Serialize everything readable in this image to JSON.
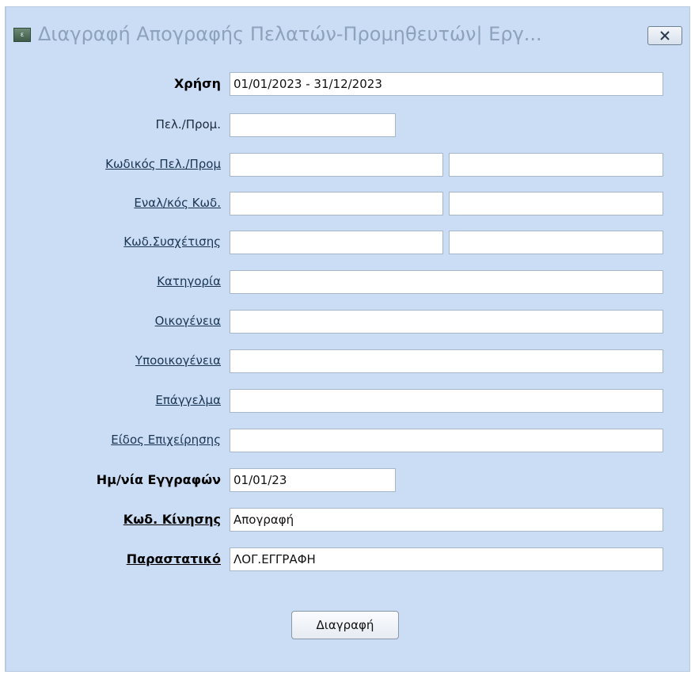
{
  "window": {
    "title": "Διαγραφή Απογραφής Πελατών-Προμηθευτών| Εργ...",
    "app_icon_text": "ε"
  },
  "form": {
    "xrisi": {
      "label": "Χρήση",
      "value": "01/01/2023 - 31/12/2023"
    },
    "pel_prom": {
      "label": "Πελ./Προμ.",
      "value": ""
    },
    "kodikos": {
      "label": "Κωδικός Πελ./Προμ",
      "from": "",
      "to": ""
    },
    "enal_kod": {
      "label": "Εναλ/κός Κωδ.",
      "from": "",
      "to": ""
    },
    "kod_sysx": {
      "label": "Κωδ.Συσχέτισης",
      "from": "",
      "to": ""
    },
    "katigoria": {
      "label": "Κατηγορία",
      "value": ""
    },
    "oikogeneia": {
      "label": "Οικογένεια",
      "value": ""
    },
    "ypooikogeneia": {
      "label": "Υποοικογένεια",
      "value": ""
    },
    "epaggelma": {
      "label": "Επάγγελμα",
      "value": ""
    },
    "eidos": {
      "label": "Είδος Επιχείρησης",
      "value": ""
    },
    "imnia": {
      "label": "Ημ/νία Εγγραφών",
      "value": "01/01/23"
    },
    "kod_kinisis": {
      "label": "Κωδ. Κίνησης",
      "value": "Απογραφή"
    },
    "parastatiko": {
      "label": "Παραστατικό",
      "value": "ΛΟΓ.ΕΓΓΡΑΦΗ"
    }
  },
  "actions": {
    "delete_label": "Διαγραφή"
  },
  "colors": {
    "window_bg": "#cbddf5",
    "title_text": "#8da2bc"
  }
}
